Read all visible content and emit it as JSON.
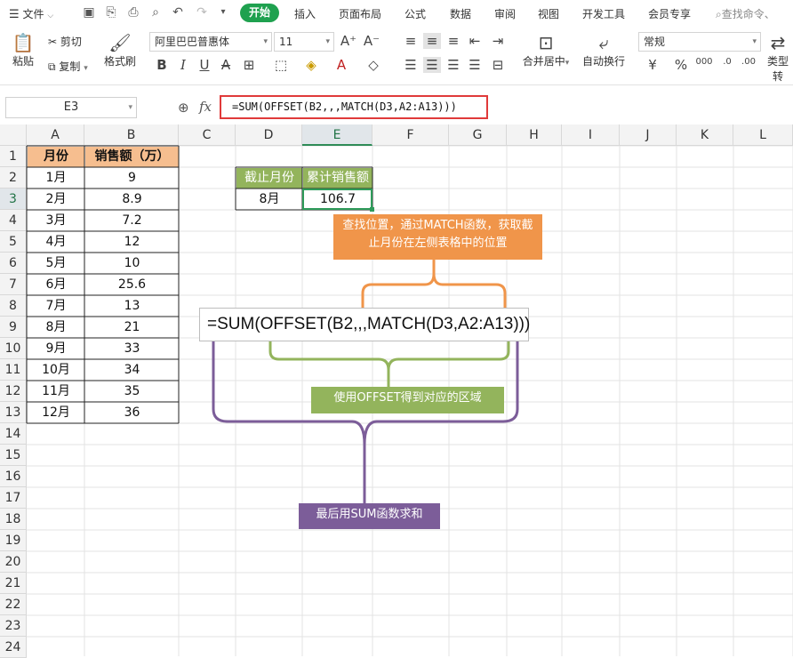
{
  "menu": {
    "file": "文件",
    "tabs": [
      "开始",
      "插入",
      "页面布局",
      "公式",
      "数据",
      "审阅",
      "视图",
      "开发工具",
      "会员专享"
    ],
    "search_placeholder": "查找命令、"
  },
  "ribbon": {
    "paste": "粘贴",
    "cut": "剪切",
    "copy": "复制",
    "format_painter": "格式刷",
    "font_name": "阿里巴巴普惠体",
    "font_size": "11",
    "number_format": "常规",
    "merge_center": "合并居中",
    "wrap_text": "自动换行",
    "type_convert": "类型转"
  },
  "formula_bar": {
    "name_box": "E3",
    "fx": "fx",
    "formula": "=SUM(OFFSET(B2,,,MATCH(D3,A2:A13)))"
  },
  "columns": [
    "A",
    "B",
    "C",
    "D",
    "E",
    "F",
    "G",
    "H",
    "I",
    "J",
    "K",
    "L"
  ],
  "rows": [
    "1",
    "2",
    "3",
    "4",
    "5",
    "6",
    "7",
    "8",
    "9",
    "10",
    "11",
    "12",
    "13",
    "14",
    "15",
    "16",
    "17",
    "18",
    "19",
    "20",
    "21",
    "22",
    "23",
    "24"
  ],
  "table": {
    "header_a": "月份",
    "header_b": "销售额（万）",
    "months": [
      "1月",
      "2月",
      "3月",
      "4月",
      "5月",
      "6月",
      "7月",
      "8月",
      "9月",
      "10月",
      "11月",
      "12月"
    ],
    "sales": [
      "9",
      "8.9",
      "7.2",
      "12",
      "10",
      "25.6",
      "13",
      "21",
      "33",
      "34",
      "35",
      "36"
    ]
  },
  "lookup": {
    "d2": "截止月份",
    "e2": "累计销售额",
    "d3": "8月",
    "e3": "106.7"
  },
  "annotations": {
    "formula_display": "=SUM(OFFSET(B2,,,MATCH(D3,A2:A13)))",
    "match_note": "查找位置，通过MATCH函数，获取截止月份在左侧表格中的位置",
    "offset_note": "使用OFFSET得到对应的区域",
    "sum_note": "最后用SUM函数求和"
  },
  "colors": {
    "orange": "#f0954a",
    "green": "#93b45c",
    "purple": "#7c5d99",
    "header_peach": "#f6be8f",
    "wps_green": "#1fa14f",
    "highlight_red": "#e03a3a"
  }
}
